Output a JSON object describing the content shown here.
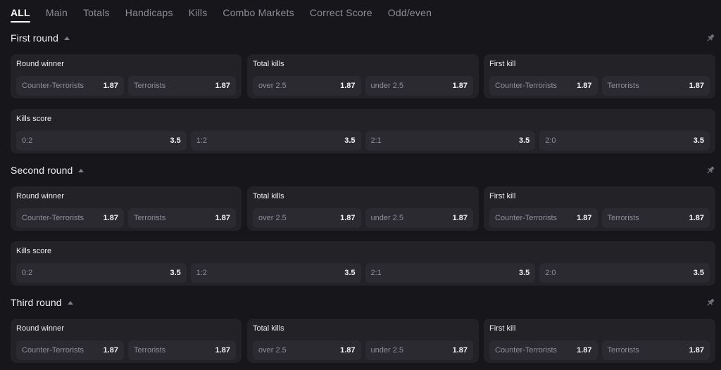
{
  "tabs": [
    {
      "label": "ALL"
    },
    {
      "label": "Main"
    },
    {
      "label": "Totals"
    },
    {
      "label": "Handicaps"
    },
    {
      "label": "Kills"
    },
    {
      "label": "Combo Markets"
    },
    {
      "label": "Correct Score"
    },
    {
      "label": "Odd/even"
    }
  ],
  "active_tab": "ALL",
  "sections": [
    {
      "title": "First round",
      "markets": [
        {
          "title": "Round winner",
          "options": [
            {
              "label": "Counter-Terrorists",
              "odds": "1.87"
            },
            {
              "label": "Terrorists",
              "odds": "1.87"
            }
          ]
        },
        {
          "title": "Total kills",
          "options": [
            {
              "label": "over 2.5",
              "odds": "1.87"
            },
            {
              "label": "under 2.5",
              "odds": "1.87"
            }
          ]
        },
        {
          "title": "First kill",
          "options": [
            {
              "label": "Counter-Terrorists",
              "odds": "1.87"
            },
            {
              "label": "Terrorists",
              "odds": "1.87"
            }
          ]
        }
      ],
      "kills_score": {
        "title": "Kills score",
        "options": [
          {
            "label": "0:2",
            "odds": "3.5"
          },
          {
            "label": "1:2",
            "odds": "3.5"
          },
          {
            "label": "2:1",
            "odds": "3.5"
          },
          {
            "label": "2:0",
            "odds": "3.5"
          }
        ]
      }
    },
    {
      "title": "Second round",
      "markets": [
        {
          "title": "Round winner",
          "options": [
            {
              "label": "Counter-Terrorists",
              "odds": "1.87"
            },
            {
              "label": "Terrorists",
              "odds": "1.87"
            }
          ]
        },
        {
          "title": "Total kills",
          "options": [
            {
              "label": "over 2.5",
              "odds": "1.87"
            },
            {
              "label": "under 2.5",
              "odds": "1.87"
            }
          ]
        },
        {
          "title": "First kill",
          "options": [
            {
              "label": "Counter-Terrorists",
              "odds": "1.87"
            },
            {
              "label": "Terrorists",
              "odds": "1.87"
            }
          ]
        }
      ],
      "kills_score": {
        "title": "Kills score",
        "options": [
          {
            "label": "0:2",
            "odds": "3.5"
          },
          {
            "label": "1:2",
            "odds": "3.5"
          },
          {
            "label": "2:1",
            "odds": "3.5"
          },
          {
            "label": "2:0",
            "odds": "3.5"
          }
        ]
      }
    },
    {
      "title": "Third round",
      "markets": [
        {
          "title": "Round winner",
          "options": [
            {
              "label": "Counter-Terrorists",
              "odds": "1.87"
            },
            {
              "label": "Terrorists",
              "odds": "1.87"
            }
          ]
        },
        {
          "title": "Total kills",
          "options": [
            {
              "label": "over 2.5",
              "odds": "1.87"
            },
            {
              "label": "under 2.5",
              "odds": "1.87"
            }
          ]
        },
        {
          "title": "First kill",
          "options": [
            {
              "label": "Counter-Terrorists",
              "odds": "1.87"
            },
            {
              "label": "Terrorists",
              "odds": "1.87"
            }
          ]
        }
      ]
    }
  ],
  "icons": {
    "collapse": "caret-up-icon",
    "pin": "pin-icon"
  },
  "colors": {
    "background": "#17171b",
    "card": "#222227",
    "odd_button": "#2a2a30",
    "active_tab": "#ffffff",
    "muted_text": "#8f8f98"
  }
}
